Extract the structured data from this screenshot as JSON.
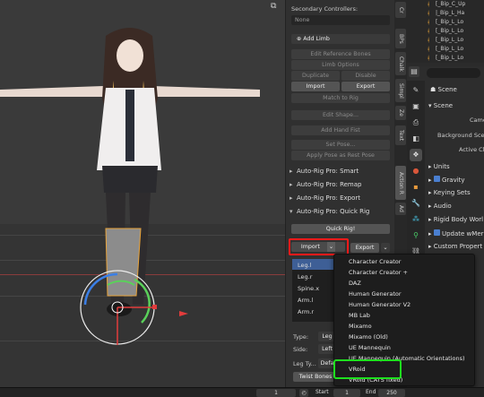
{
  "npanel": {
    "secondary_controllers_label": "Secondary Controllers:",
    "secondary_value": "None",
    "add_limb": "Add Limb",
    "edit_reference_bones": "Edit Reference Bones",
    "limb_options": "Limb Options",
    "duplicate": "Duplicate",
    "disable": "Disable",
    "import": "Import",
    "export": "Export",
    "match_to_rig": "Match to Rig",
    "edit_shape": "Edit Shape...",
    "add_hand_fist": "Add Hand Fist",
    "set_pose": "Set Pose...",
    "apply_pose_as_rest": "Apply Pose as Rest Pose",
    "sections": [
      "Auto-Rig Pro: Smart",
      "Auto-Rig Pro: Remap",
      "Auto-Rig Pro: Export",
      "Auto-Rig Pro: Quick Rig"
    ],
    "quick_rig": "Quick Rig!",
    "quick_import": "Import",
    "quick_export": "Export",
    "bones": [
      "Leg.l",
      "Leg.r",
      "Spine.x",
      "Arm.l",
      "Arm.r"
    ],
    "type_label": "Type:",
    "type_value": "Leg",
    "side_label": "Side:",
    "side_value": "Left",
    "leg_type_label": "Leg Ty...",
    "leg_type_value": "Defa",
    "twist_bones": "Twist Bones"
  },
  "tabs": [
    "Cr",
    "BPs",
    "Chalk",
    "Simpl",
    "Ze",
    "Text",
    "Action R",
    "Ad"
  ],
  "outliner": {
    "rows": [
      "[_Bip_C_Up",
      "|_Bip_L_Ha",
      "[_Bip_L_Lo",
      "[_Bip_L_Lo",
      "[_Bip_L_Lo",
      "[_Bip_L_Lo",
      "[_Bip_L_Lo"
    ]
  },
  "properties": {
    "scene_header": "Scene",
    "scene_panel": "Scene",
    "camera": "Camer",
    "background": "Background Sce",
    "active_clip": "Active Cl",
    "units": "Units",
    "gravity": "Gravity",
    "keying_sets": "Keying Sets",
    "audio": "Audio",
    "rigid_body": "Rigid Body Worl",
    "update_wmesh": "Update wMer",
    "custom_props": "Custom Propert"
  },
  "menu": {
    "items": [
      "Character Creator",
      "Character Creator +",
      "DAZ",
      "Human Generator",
      "Human Generator V2",
      "MB Lab",
      "Mixamo",
      "Mixamo (Old)",
      "UE Mannequin",
      "UE Mannequin (Automatic Orientations)",
      "VRoid",
      "VRoid (CATS fixed)"
    ],
    "highlighted": "VRoid"
  },
  "timeline": {
    "current_frame": "1",
    "start_label": "Start",
    "start_value": "1",
    "end_label": "End",
    "end_value": "250"
  },
  "colors": {
    "highlight": "#ff1a1a",
    "highlight2": "#1ee01e",
    "accent": "#4a7fd0",
    "bone_orange": "#e8a33a"
  }
}
